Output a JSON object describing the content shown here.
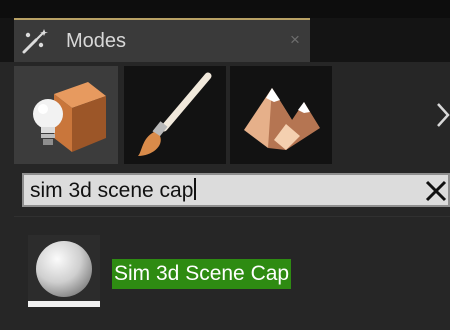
{
  "modes_tab": {
    "title": "Modes",
    "icon": "modes-wand-icon",
    "close_glyph": "×"
  },
  "mode_buttons": [
    {
      "name": "place-mode",
      "icon": "cube-lightbulb-icon",
      "active": true
    },
    {
      "name": "paint-mode",
      "icon": "paintbrush-icon",
      "active": false
    },
    {
      "name": "landscape-mode",
      "icon": "mountains-icon",
      "active": false
    }
  ],
  "more_modes_icon": "chevron-right-icon",
  "search": {
    "value": "sim 3d scene cap",
    "clear_glyph": "×"
  },
  "results": [
    {
      "label": "Sim 3d Scene Cap",
      "icon": "sphere-icon",
      "highlight_color": "#2e8b12"
    }
  ],
  "colors": {
    "tab_accent": "#b8a165",
    "active_tab": "#3a3a3a",
    "panel_bg": "#262626"
  }
}
